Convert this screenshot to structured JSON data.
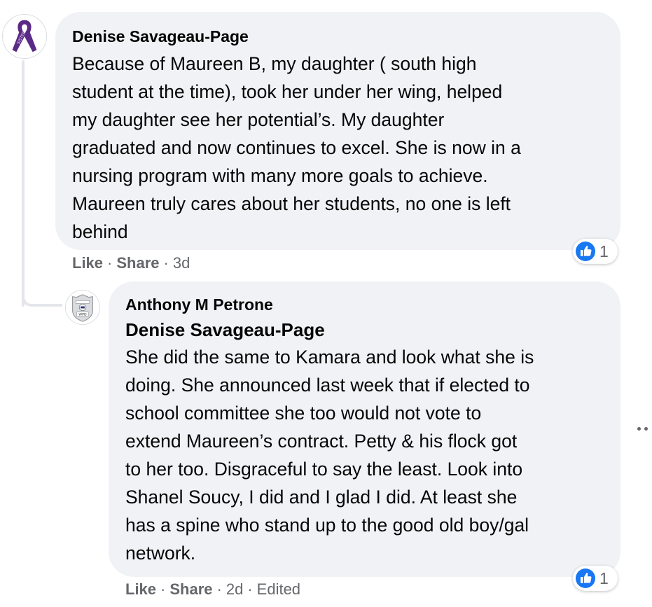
{
  "comments": [
    {
      "author": "Denise Savageau-Page",
      "avatar_icon": "purple-ribbon-avatar-icon",
      "avatar_ribbon_text": "SISTER",
      "text": "Because of Maureen B, my daughter ( south high\nstudent at the time), took her under her wing, helped\nmy daughter see her potential’s. My daughter\ngraduated and now continues to excel. She is now in a\nnursing program with many more goals to achieve.\nMaureen truly cares about her students, no one is left\nbehind",
      "reaction_icon": "like-icon",
      "reaction_count": "1",
      "like_label": "Like",
      "share_label": "Share",
      "separator": "·",
      "timestamp": "3d"
    },
    {
      "author": "Anthony M Petrone",
      "avatar_icon": "police-badge-avatar-icon",
      "avatar_badge_text": "WPD",
      "mention": "Denise Savageau-Page",
      "text": "She did the same to Kamara and look what she is\ndoing. She announced last week that if elected to\nschool committee she too would not vote to\nextend Maureen’s contract. Petty & his flock got\nto her too. Disgraceful to say the least. Look into\nShanel Soucy, I did and I glad I did. At least she\nhas a spine who stand up to the good old boy/gal\nnetwork.",
      "reaction_icon": "like-icon",
      "reaction_count": "1",
      "like_label": "Like",
      "share_label": "Share",
      "separator": "·",
      "timestamp": "2d",
      "edited_label": "Edited"
    }
  ],
  "more_options_icon": "more-dots-icon",
  "colors": {
    "bubble_bg": "#f0f2f5",
    "text": "#050505",
    "secondary_text": "#65676b",
    "like_blue": "#1877f2",
    "ribbon_purple": "#5b2a86",
    "thread_line": "#e4e6eb"
  }
}
